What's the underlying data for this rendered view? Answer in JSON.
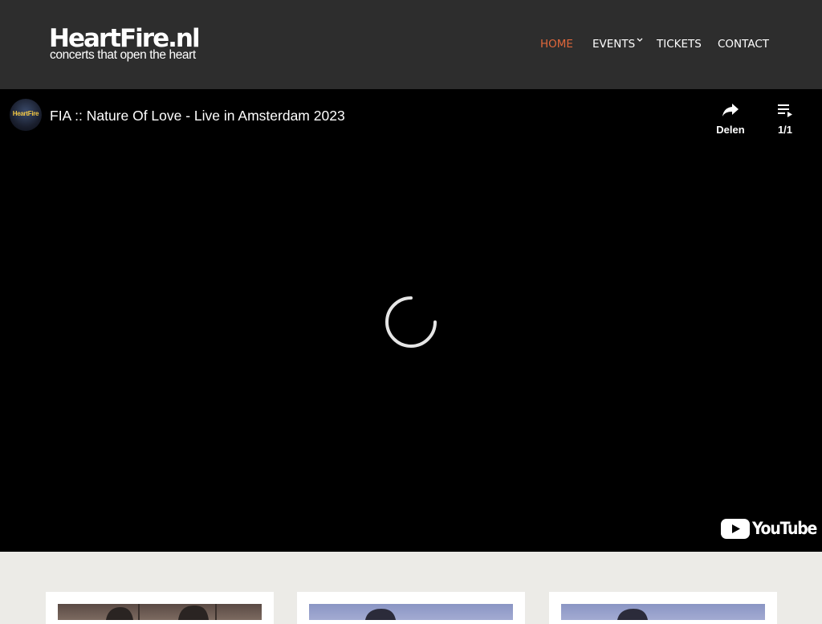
{
  "site": {
    "logo_title": "HeartFire.nl",
    "logo_tagline": "concerts that open the heart"
  },
  "nav": {
    "items": [
      {
        "label": "HOME",
        "active": true
      },
      {
        "label": "EVENTS",
        "has_dropdown": true
      },
      {
        "label": "TICKETS"
      },
      {
        "label": "CONTACT"
      }
    ]
  },
  "video": {
    "channel_avatar_text": "HeartFire",
    "title": "FIA :: Nature Of Love - Live in Amsterdam 2023",
    "share_label": "Delen",
    "playlist_label": "1/1",
    "brand": "YouTube",
    "state": "loading"
  },
  "colors": {
    "header_bg": "#2d2d2d",
    "nav_active": "#e0673b",
    "page_bg": "#ecebe7",
    "video_bg": "#000000"
  },
  "icons": {
    "share": "share-arrow-icon",
    "playlist": "playlist-icon",
    "spinner": "loading-spinner-icon",
    "youtube": "youtube-logo-icon",
    "dropdown": "chevron-down-icon"
  }
}
